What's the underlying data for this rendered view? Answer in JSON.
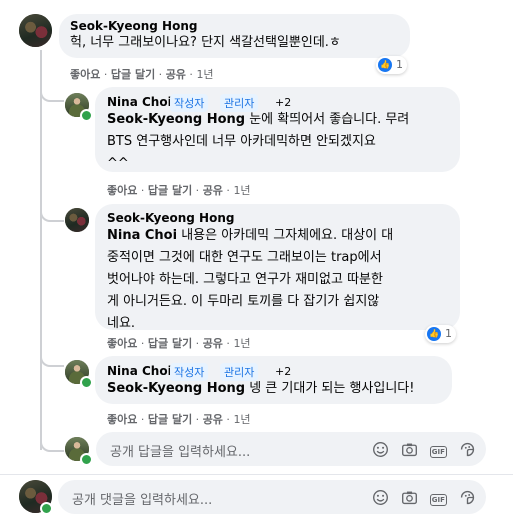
{
  "comment1": {
    "author": "Seok-Kyeong Hong",
    "text": "헉, 너무 그래보이나요? 단지 색갈선택일뿐인데.ㅎ",
    "reaction_count": "1",
    "actions": {
      "like": "좋아요",
      "reply": "답글 달기",
      "share": "공유",
      "time": "1년"
    }
  },
  "reply1": {
    "author": "Nina Choi",
    "badges": [
      "작성자",
      "관리자"
    ],
    "extra": "+2",
    "mention": "Seok-Kyeong Hong",
    "line1": " 눈에 확띄어서 좋습니다. 무려",
    "line2": "BTS 연구행사인데 너무 아카데믹하면 안되겠지요",
    "line3": "^^",
    "actions": {
      "like": "좋아요",
      "reply": "답글 달기",
      "share": "공유",
      "time": "1년"
    }
  },
  "reply2": {
    "author": "Seok-Kyeong Hong",
    "mention": "Nina Choi",
    "line1": " 내용은 아카데믹 그자체에요. 대상이 대",
    "line2": "중적이면 그것에 대한 연구도 그래보이는 trap에서",
    "line3": "벗어나야 하는데. 그렇다고 연구가 재미없고 따분한",
    "line4": "게 아니거든요. 이 두마리 토끼를 다 잡기가 쉽지않",
    "line5": "네요.",
    "reaction_count": "1",
    "actions": {
      "like": "좋아요",
      "reply": "답글 달기",
      "share": "공유",
      "time": "1년"
    }
  },
  "reply3": {
    "author": "Nina Choi",
    "badges": [
      "작성자",
      "관리자"
    ],
    "extra": "+2",
    "mention": "Seok-Kyeong Hong",
    "text": " 넹 큰 기대가 되는 행사입니다!",
    "actions": {
      "like": "좋아요",
      "reply": "답글 달기",
      "share": "공유",
      "time": "1년"
    }
  },
  "reply_input": {
    "placeholder": "공개 답글을 입력하세요...",
    "gif_label": "GIF"
  },
  "comment_input": {
    "placeholder": "공개 댓글을 입력하세요...",
    "gif_label": "GIF"
  },
  "icons": [
    "emoji-icon",
    "camera-icon",
    "gif-icon",
    "sticker-icon"
  ],
  "colors": {
    "link_blue": "#1b74e4",
    "like_blue": "#1877f2",
    "bubble_gray": "#f0f2f5",
    "meta_gray": "#65676b",
    "online_green": "#31a24c"
  }
}
